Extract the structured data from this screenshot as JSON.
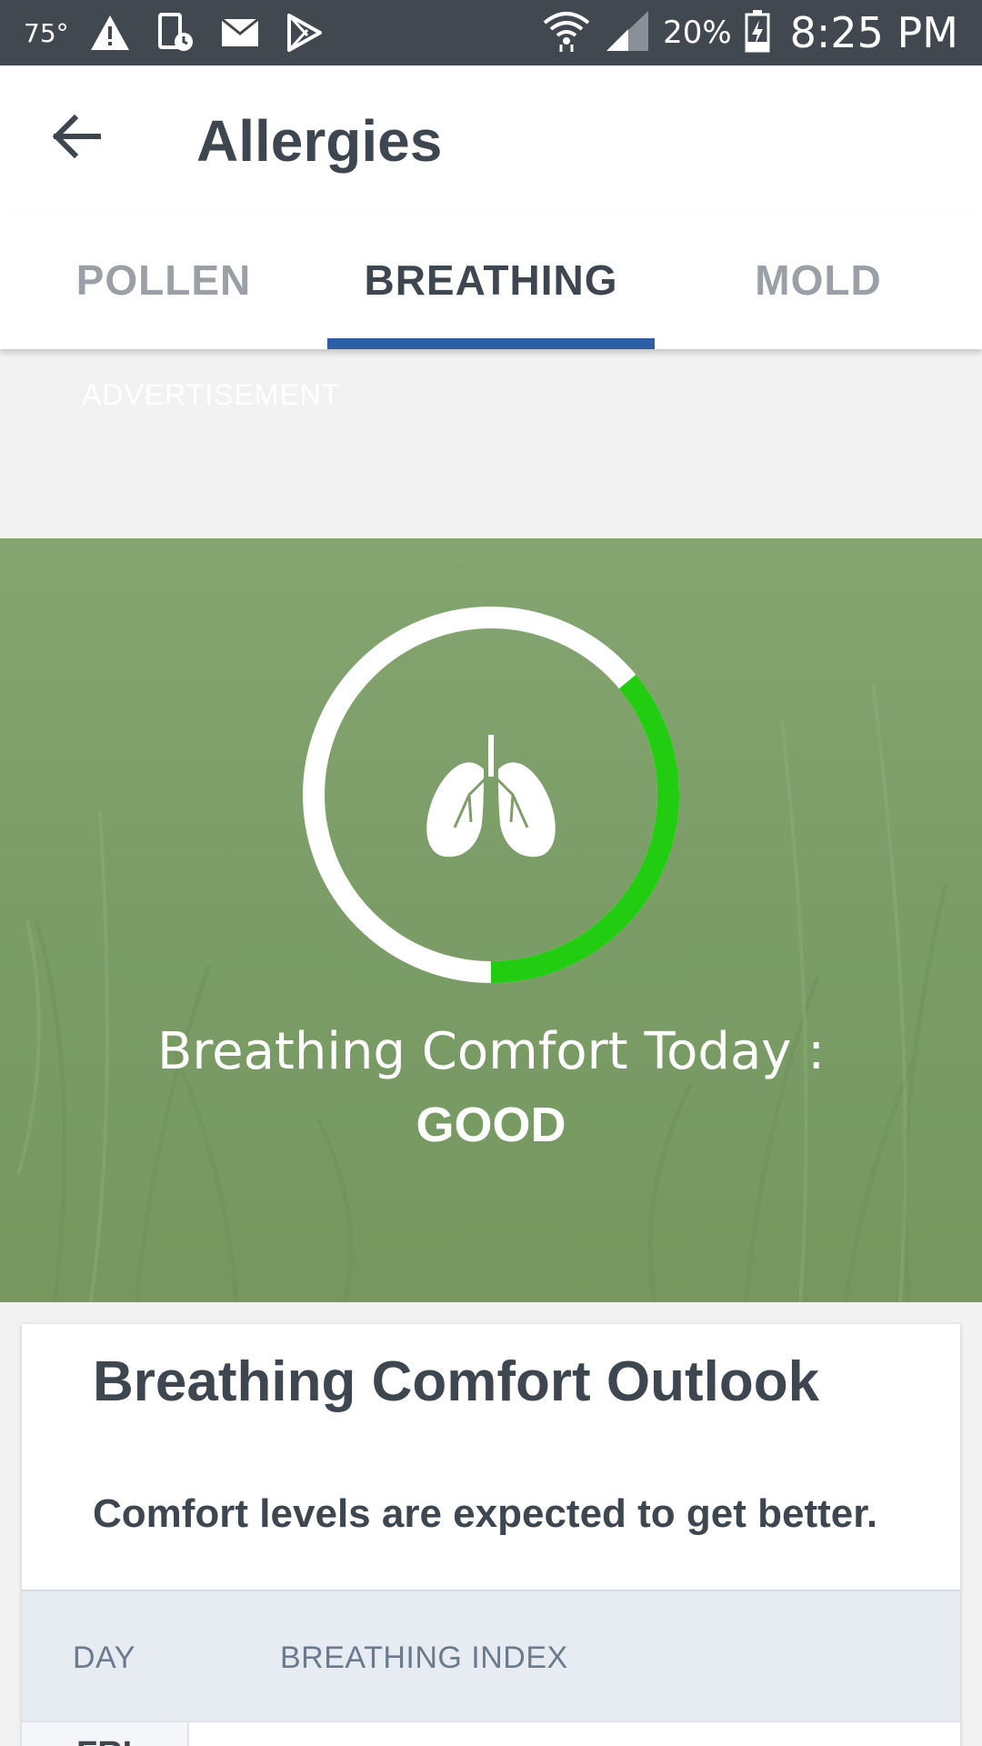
{
  "status_bar": {
    "temperature": "75°",
    "battery": "20%",
    "time": "8:25 PM"
  },
  "appbar": {
    "title": "Allergies"
  },
  "tabs": [
    {
      "label": "POLLEN"
    },
    {
      "label": "BREATHING"
    },
    {
      "label": "MOLD"
    }
  ],
  "active_tab": "BREATHING",
  "ad": {
    "label": "ADVERTISEMENT"
  },
  "hero": {
    "line1": "Breathing Comfort Today :",
    "line2": "GOOD",
    "gauge_fraction": 0.36,
    "gauge_color": "#22cc11",
    "gauge_track_color": "#ffffff",
    "background_color": "#7e9e69"
  },
  "outlook": {
    "title": "Breathing Comfort Outlook",
    "subtitle": "Comfort levels are expected to get better.",
    "columns": [
      "DAY",
      "BREATHING INDEX"
    ],
    "rows": [
      {
        "day": "FRI",
        "index": ""
      }
    ]
  },
  "colors": {
    "status_bar": "#41484f",
    "tab_indicator": "#2d5fa8",
    "text_dark": "#3e4650"
  }
}
